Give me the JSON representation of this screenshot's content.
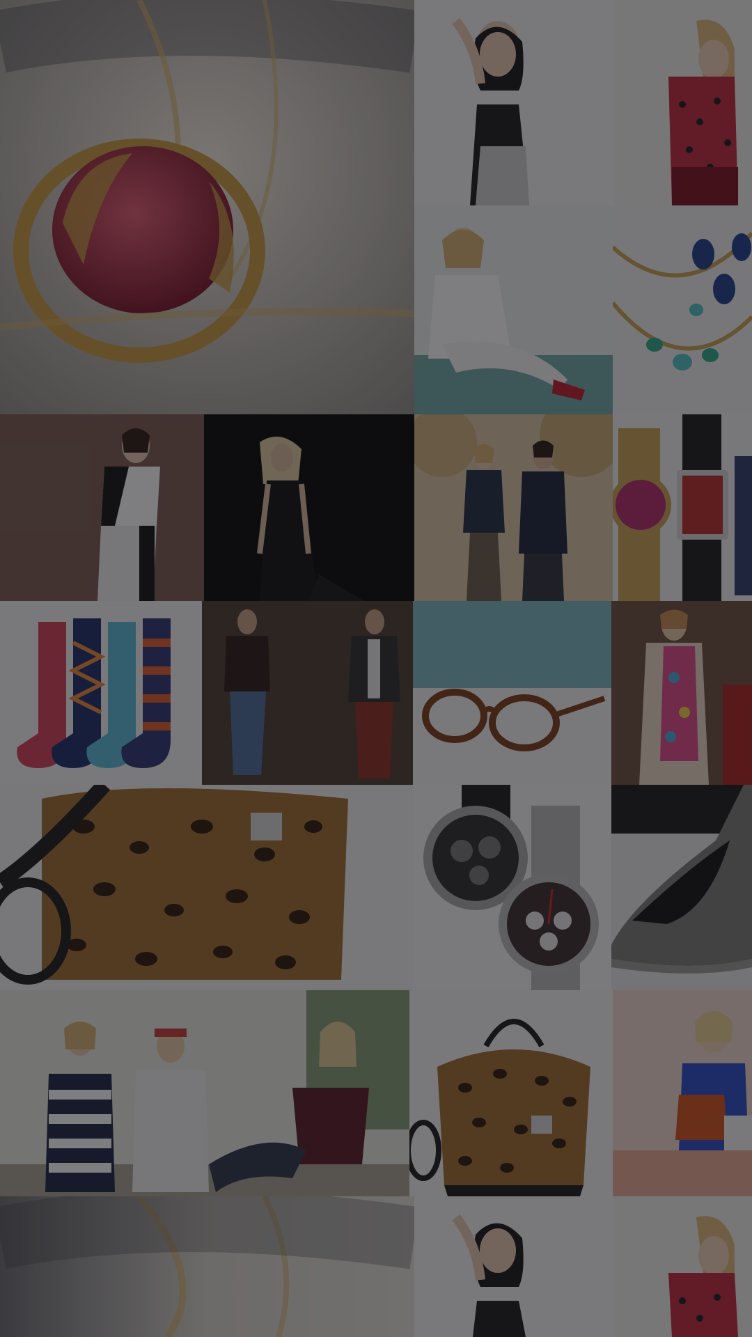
{
  "screen": {
    "kind": "fashion-product-collage-background",
    "overlay_color": "#141418"
  },
  "tiles": [
    {
      "id": "ruby-ring",
      "icon": "ring-icon",
      "subject": "ruby-ring",
      "bg": "#d9d4cc",
      "accent": "#b3364a"
    },
    {
      "id": "woman-sequin-tank",
      "icon": "person-icon",
      "subject": "woman",
      "bg": "#f4f4f4",
      "accent": "#222222"
    },
    {
      "id": "woman-red-polka-dress",
      "icon": "person-icon",
      "subject": "woman",
      "bg": "#f2efec",
      "accent": "#c2273d"
    },
    {
      "id": "woman-white-outfit-red-heels",
      "icon": "person-icon",
      "subject": "woman",
      "bg": "#eef0f0",
      "accent": "#ffffff"
    },
    {
      "id": "gemstone-necklaces",
      "icon": "necklace-icon",
      "subject": "necklace",
      "bg": "#f0f0f0",
      "accent": "#1e3c8c"
    },
    {
      "id": "woman-black-white-top",
      "icon": "person-icon",
      "subject": "woman",
      "bg": "#7a5a4e",
      "accent": "#ffffff"
    },
    {
      "id": "woman-black-dress",
      "icon": "person-icon",
      "subject": "woman",
      "bg": "#050505",
      "accent": "#e0c9a0"
    },
    {
      "id": "couple-autumn-walk",
      "icon": "person-icon",
      "subject": "couple",
      "bg": "#d9c6a4",
      "accent": "#1f2a44"
    },
    {
      "id": "vivienne-westwood-watches",
      "icon": "watch-icon",
      "subject": "watches",
      "bg": "#f2f2f2",
      "accent": "#b3286a"
    },
    {
      "id": "patterned-socks",
      "icon": "sock-icon",
      "subject": "socks",
      "bg": "#f4f4f4",
      "accent": "#d23c52"
    },
    {
      "id": "men-sweater-blazer",
      "icon": "person-icon",
      "subject": "men",
      "bg": "#4a3a30",
      "accent": "#8a2a20"
    },
    {
      "id": "tortoiseshell-glasses",
      "icon": "glasses-icon",
      "subject": "glasses",
      "bg": "#f4f4f4",
      "accent": "#7a3a14"
    },
    {
      "id": "woman-trench-floral-dress",
      "icon": "person-icon",
      "subject": "woman",
      "bg": "#6a4c3a",
      "accent": "#e0478a"
    },
    {
      "id": "leopard-handbag-closeup",
      "icon": "handbag-icon",
      "subject": "handbag",
      "bg": "#f2f2f2",
      "accent": "#8a5a20"
    },
    {
      "id": "chronograph-watches",
      "icon": "watch-icon",
      "subject": "watches",
      "bg": "#f6f6f6",
      "accent": "#333333"
    },
    {
      "id": "grey-suede-pump",
      "icon": "shoe-icon",
      "subject": "shoe",
      "bg": "#e8e8e8",
      "accent": "#7a7a78"
    },
    {
      "id": "women-knitwear-outdoor",
      "icon": "person-icon",
      "subject": "women",
      "bg": "#e8e8e2",
      "accent": "#5a1a24"
    },
    {
      "id": "leopard-handbag-full",
      "icon": "handbag-icon",
      "subject": "handbag",
      "bg": "#f4f4f4",
      "accent": "#8a5a20"
    },
    {
      "id": "woman-blue-top-orange-bag",
      "icon": "person-icon",
      "subject": "woman",
      "bg": "#f0d8cc",
      "accent": "#2848c8"
    },
    {
      "id": "ruby-ring-repeat",
      "icon": "ring-icon",
      "subject": "ruby-ring",
      "bg": "#d9d4cc",
      "accent": "#b3364a"
    },
    {
      "id": "woman-sequin-tank-repeat",
      "icon": "person-icon",
      "subject": "woman",
      "bg": "#f4f4f4",
      "accent": "#222222"
    },
    {
      "id": "woman-red-polka-dress-repeat",
      "icon": "person-icon",
      "subject": "woman",
      "bg": "#f2efec",
      "accent": "#c2273d"
    }
  ]
}
